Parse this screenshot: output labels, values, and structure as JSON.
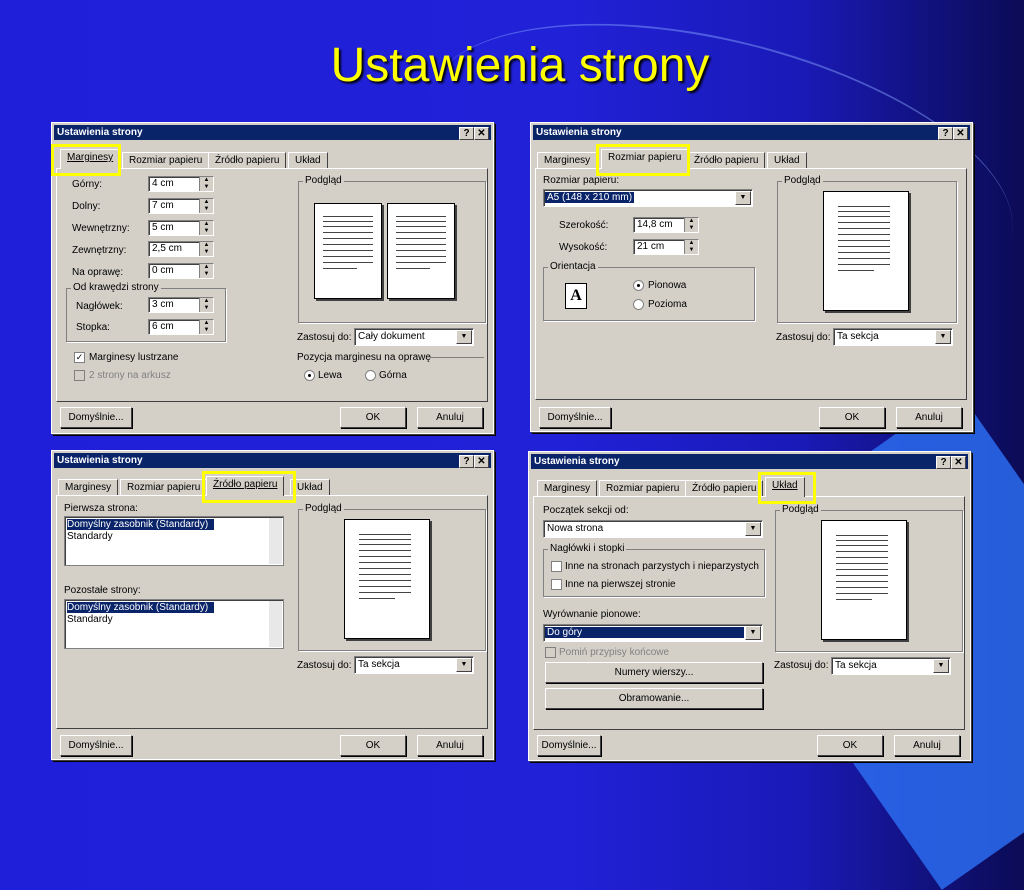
{
  "slide_title": "Ustawienia strony",
  "dialog_title": "Ustawienia strony",
  "title_buttons": {
    "help": "?",
    "close": "✕"
  },
  "tabs": [
    "Marginesy",
    "Rozmiar papieru",
    "Źródło papieru",
    "Układ"
  ],
  "buttons": {
    "default": "Domyślnie...",
    "ok": "OK",
    "cancel": "Anuluj"
  },
  "preview_label": "Podgląd",
  "apply_label": "Zastosuj do:",
  "margins": {
    "top_label": "Górny:",
    "top_value": "4 cm",
    "bottom_label": "Dolny:",
    "bottom_value": "7 cm",
    "inner_label": "Wewnętrzny:",
    "inner_value": "5 cm",
    "outer_label": "Zewnętrzny:",
    "outer_value": "2,5 cm",
    "gutter_label": "Na oprawę:",
    "gutter_value": "0 cm",
    "from_edge_group": "Od krawędzi strony",
    "header_label": "Nagłówek:",
    "header_value": "3 cm",
    "footer_label": "Stopka:",
    "footer_value": "6 cm",
    "mirror_label": "Marginesy lustrzane",
    "two_pages_label": "2 strony na arkusz",
    "apply_value": "Cały dokument",
    "gutter_pos_label": "Pozycja marginesu na oprawę",
    "gutter_left": "Lewa",
    "gutter_top": "Górna"
  },
  "paper_size": {
    "size_label": "Rozmiar papieru:",
    "size_value": "A5 (148 x 210 mm)",
    "width_label": "Szerokość:",
    "width_value": "14,8 cm",
    "height_label": "Wysokość:",
    "height_value": "21 cm",
    "orientation_group": "Orientacja",
    "portrait": "Pionowa",
    "landscape": "Pozioma",
    "orientation_icon": "A",
    "apply_value": "Ta sekcja"
  },
  "paper_source": {
    "first_page_label": "Pierwsza strona:",
    "first_page_items": [
      "Domyślny zasobnik (Standardy)",
      "Standardy"
    ],
    "other_pages_label": "Pozostałe strony:",
    "other_pages_items": [
      "Domyślny zasobnik (Standardy)",
      "Standardy"
    ],
    "apply_value": "Ta sekcja"
  },
  "layout": {
    "section_start_label": "Początek sekcji od:",
    "section_start_value": "Nowa strona",
    "headers_group": "Nagłówki i stopki",
    "odd_even_label": "Inne na stronach parzystych i nieparzystych",
    "first_page_label": "Inne na pierwszej stronie",
    "valign_label": "Wyrównanie pionowe:",
    "valign_value": "Do góry",
    "suppress_endnotes": "Pomiń przypisy końcowe",
    "line_numbers_button": "Numery wierszy...",
    "borders_button": "Obramowanie...",
    "apply_value": "Ta sekcja"
  },
  "colors": {
    "highlight": "#ffff00",
    "title_text": "#ffff00",
    "background": "#2121d8",
    "titlebar": "#0a246a",
    "dialog": "#d4d0c8"
  }
}
